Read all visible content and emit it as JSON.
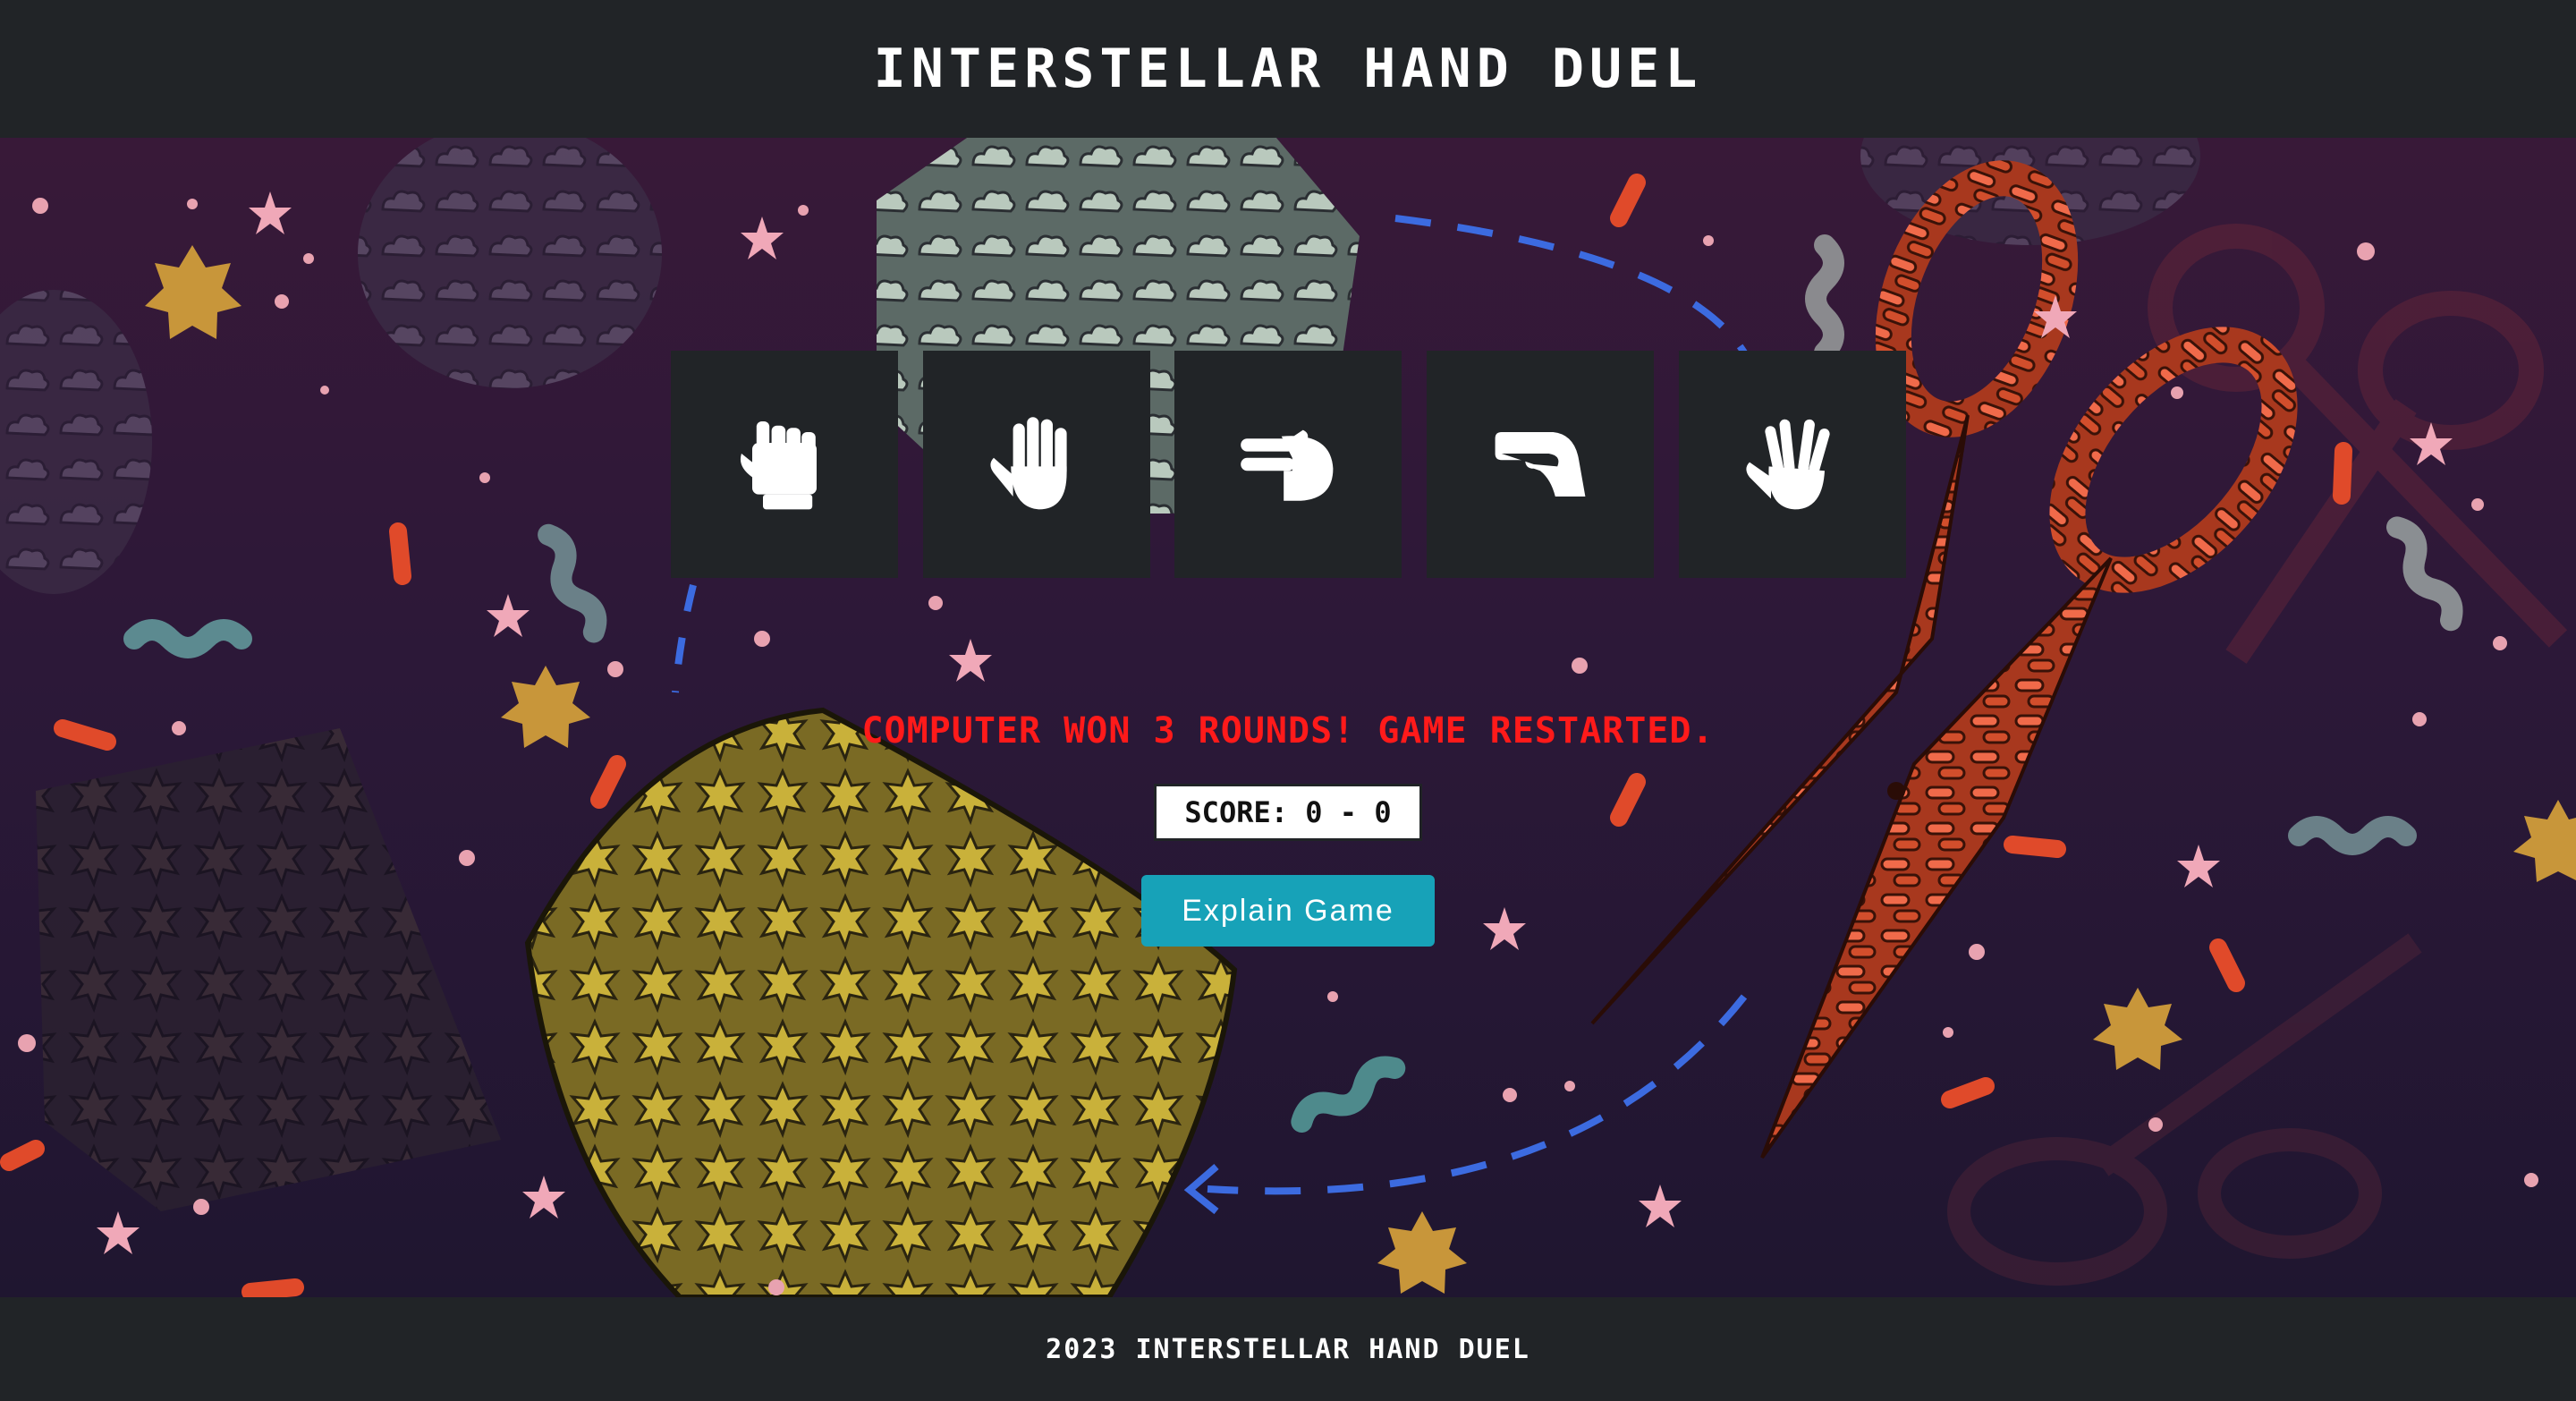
{
  "header": {
    "title": "INTERSTELLAR HAND DUEL"
  },
  "choices": [
    {
      "name": "rock",
      "icon": "fist-icon"
    },
    {
      "name": "paper",
      "icon": "open-hand-icon"
    },
    {
      "name": "scissors",
      "icon": "scissors-hand-icon"
    },
    {
      "name": "lizard",
      "icon": "lizard-hand-icon"
    },
    {
      "name": "spock",
      "icon": "spock-hand-icon"
    }
  ],
  "result": {
    "message": "COMPUTER WON 3 ROUNDS! GAME RESTARTED."
  },
  "score": {
    "text": "SCORE: 0 - 0"
  },
  "explain_button": {
    "label": "Explain Game"
  },
  "footer": {
    "text": "2023 INTERSTELLAR HAND DUEL"
  },
  "colors": {
    "bar": "#212427",
    "result_red": "#ff1a1a",
    "button_teal": "#17a2b8",
    "background_purple": "#381938"
  }
}
